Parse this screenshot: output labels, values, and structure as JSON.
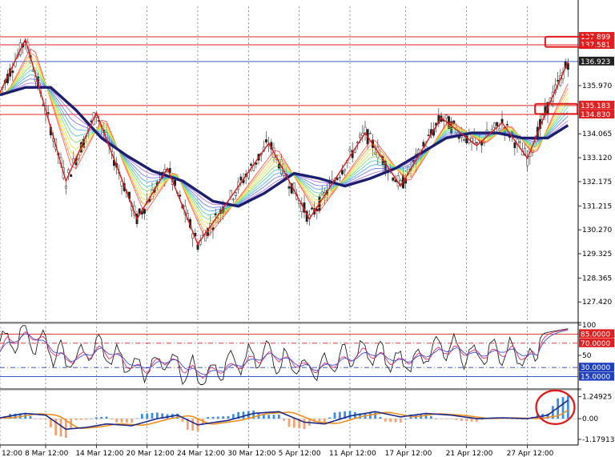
{
  "chart_data": {
    "type": "line",
    "panes": [
      {
        "id": "price",
        "ylim": [
          126.7,
          139.1
        ],
        "y_ticks": [
          "127.420",
          "128.365",
          "129.325",
          "130.270",
          "131.215",
          "132.175",
          "133.120",
          "134.065",
          "135.970"
        ],
        "tick_values": [
          127.42,
          128.365,
          129.325,
          130.27,
          131.215,
          132.175,
          133.12,
          134.065,
          135.97
        ],
        "badges": [
          {
            "label": "137.899",
            "value": 137.899,
            "color": "#e02020"
          },
          {
            "label": "137.581",
            "value": 137.581,
            "color": "#e02020"
          },
          {
            "label": "136.923",
            "value": 136.923,
            "color": "#222222"
          },
          {
            "label": "135.183",
            "value": 135.183,
            "color": "#e02020"
          },
          {
            "label": "134.830",
            "value": 134.83,
            "color": "#e02020"
          }
        ],
        "horizontal_lines": [
          {
            "value": 137.899,
            "color": "#e02020"
          },
          {
            "value": 137.581,
            "color": "#e02020"
          },
          {
            "value": 136.923,
            "color": "#3a5fcd"
          },
          {
            "value": 135.183,
            "color": "#e02020"
          },
          {
            "value": 134.83,
            "color": "#e02020"
          }
        ],
        "zigzag": [
          {
            "x": 0,
            "y": 135.7
          },
          {
            "x": 5,
            "y": 137.8
          },
          {
            "x": 13,
            "y": 132.2
          },
          {
            "x": 19,
            "y": 134.9
          },
          {
            "x": 27,
            "y": 130.7
          },
          {
            "x": 33,
            "y": 132.7
          },
          {
            "x": 39,
            "y": 129.7
          },
          {
            "x": 53,
            "y": 133.7
          },
          {
            "x": 61,
            "y": 130.7
          },
          {
            "x": 72,
            "y": 134.1
          },
          {
            "x": 79,
            "y": 132.0
          },
          {
            "x": 87,
            "y": 134.7
          },
          {
            "x": 94,
            "y": 133.6
          },
          {
            "x": 99,
            "y": 134.5
          },
          {
            "x": 104,
            "y": 133.1
          },
          {
            "x": 108,
            "y": 135.1
          },
          {
            "x": 112,
            "y": 136.9
          }
        ],
        "slow_ma": [
          {
            "x": 0,
            "y": 135.6
          },
          {
            "x": 5,
            "y": 135.9
          },
          {
            "x": 10,
            "y": 135.9
          },
          {
            "x": 15,
            "y": 135.0
          },
          {
            "x": 20,
            "y": 133.9
          },
          {
            "x": 25,
            "y": 133.2
          },
          {
            "x": 30,
            "y": 132.6
          },
          {
            "x": 36,
            "y": 132.2
          },
          {
            "x": 42,
            "y": 131.4
          },
          {
            "x": 47,
            "y": 131.2
          },
          {
            "x": 52,
            "y": 131.7
          },
          {
            "x": 58,
            "y": 132.5
          },
          {
            "x": 63,
            "y": 132.3
          },
          {
            "x": 68,
            "y": 132.0
          },
          {
            "x": 73,
            "y": 132.3
          },
          {
            "x": 78,
            "y": 132.7
          },
          {
            "x": 83,
            "y": 133.3
          },
          {
            "x": 88,
            "y": 133.9
          },
          {
            "x": 93,
            "y": 134.1
          },
          {
            "x": 98,
            "y": 134.1
          },
          {
            "x": 103,
            "y": 133.9
          },
          {
            "x": 108,
            "y": 133.9
          },
          {
            "x": 112,
            "y": 134.4
          }
        ]
      },
      {
        "id": "oscillator",
        "ylim": [
          0,
          100
        ],
        "y_ticks": [
          "100",
          "50"
        ],
        "tick_values": [
          100,
          50
        ],
        "badges": [
          {
            "label": "85.0000",
            "value": 85,
            "color": "#e02020"
          },
          {
            "label": "70.0000",
            "value": 70,
            "color": "#e02020"
          },
          {
            "label": "30.0000",
            "value": 30,
            "color": "#2040c0"
          },
          {
            "label": "15.0000",
            "value": 15,
            "color": "#2040c0"
          }
        ],
        "levels": [
          {
            "value": 85,
            "color": "#e02020",
            "dash": false
          },
          {
            "value": 70,
            "color": "#e02020",
            "dash": true
          },
          {
            "value": 30,
            "color": "#2040c0",
            "dash": true
          },
          {
            "value": 15,
            "color": "#2040c0",
            "dash": false
          }
        ]
      },
      {
        "id": "histogram",
        "ylim": [
          -1.5,
          1.6
        ],
        "y_ticks": [
          "1.24925",
          "0.00",
          "-1.17913"
        ],
        "tick_values": [
          1.24925,
          0,
          -1.17913
        ],
        "signal_line": [
          {
            "x": 0,
            "y": 0.05
          },
          {
            "x": 5,
            "y": 0.3
          },
          {
            "x": 9,
            "y": 0.2
          },
          {
            "x": 13,
            "y": -0.6
          },
          {
            "x": 17,
            "y": -0.5
          },
          {
            "x": 21,
            "y": -0.3
          },
          {
            "x": 26,
            "y": -0.4
          },
          {
            "x": 31,
            "y": 0.0
          },
          {
            "x": 35,
            "y": 0.2
          },
          {
            "x": 39,
            "y": -0.35
          },
          {
            "x": 45,
            "y": -0.1
          },
          {
            "x": 50,
            "y": 0.3
          },
          {
            "x": 55,
            "y": 0.4
          },
          {
            "x": 60,
            "y": -0.2
          },
          {
            "x": 64,
            "y": -0.3
          },
          {
            "x": 69,
            "y": 0.15
          },
          {
            "x": 74,
            "y": 0.4
          },
          {
            "x": 79,
            "y": 0.1
          },
          {
            "x": 84,
            "y": 0.3
          },
          {
            "x": 89,
            "y": 0.2
          },
          {
            "x": 94,
            "y": 0.0
          },
          {
            "x": 99,
            "y": 0.05
          },
          {
            "x": 104,
            "y": 0.0
          },
          {
            "x": 108,
            "y": 0.2
          },
          {
            "x": 112,
            "y": 1.05
          }
        ]
      }
    ],
    "x_ticks": [
      "12:00",
      "8 Mar 12:00",
      "14 Mar 12:00",
      "20 Mar 12:00",
      "24 Mar 12:00",
      "30 Mar 12:00",
      "5 Apr 12:00",
      "11 Apr 12:00",
      "17 Apr 12:00",
      "21 Apr 12:00",
      "27 Apr 12:00"
    ],
    "x_tick_index": [
      0,
      9,
      19,
      29,
      39,
      49,
      59,
      69,
      80,
      92,
      104
    ],
    "x_range": [
      0,
      114
    ],
    "grid": true,
    "highlight_boxes": [
      "resistance-box",
      "support-box"
    ],
    "highlight_circle": "histogram-peak"
  }
}
